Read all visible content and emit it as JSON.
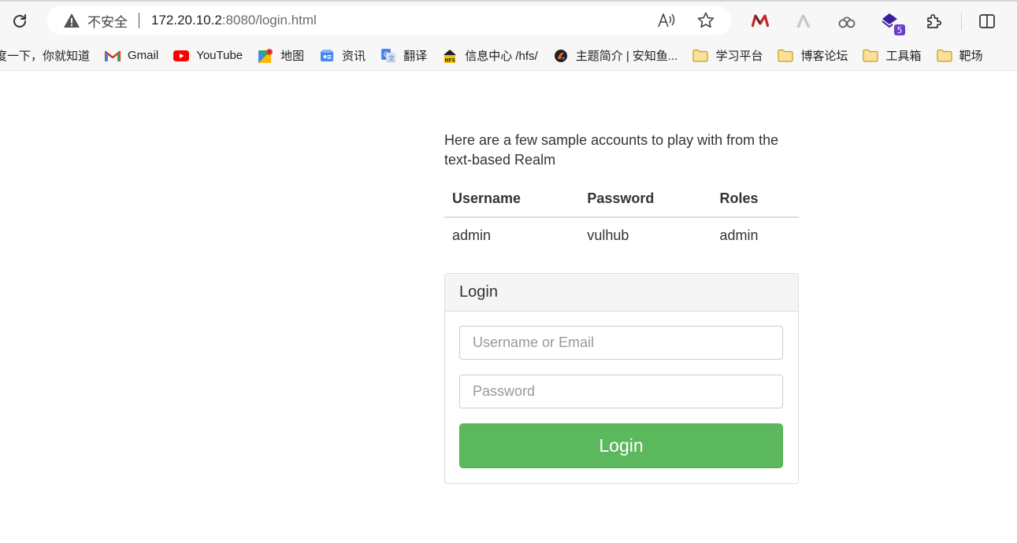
{
  "browser": {
    "security_label": "不安全",
    "url_host": "172.20.10.2",
    "url_rest": ":8080/login.html",
    "extension_badge": "5",
    "icons": {
      "reload": "reload-icon",
      "security": "warning-icon",
      "read_aloud": "read-aloud-icon",
      "favorite": "star-icon",
      "extensions": "puzzle-icon",
      "split_screen": "split-screen-icon"
    }
  },
  "bookmarks": [
    {
      "label": "度一下，你就知道",
      "icon": "baidu-icon"
    },
    {
      "label": "Gmail",
      "icon": "gmail-icon"
    },
    {
      "label": "YouTube",
      "icon": "youtube-icon"
    },
    {
      "label": "地图",
      "icon": "maps-icon"
    },
    {
      "label": "资讯",
      "icon": "news-icon"
    },
    {
      "label": "翻译",
      "icon": "translate-icon"
    },
    {
      "label": "信息中心 /hfs/",
      "icon": "hfs-icon"
    },
    {
      "label": "主题简介 | 安知鱼...",
      "icon": "anzhiyu-icon"
    },
    {
      "label": "学习平台",
      "icon": "folder-icon"
    },
    {
      "label": "博客论坛",
      "icon": "folder-icon"
    },
    {
      "label": "工具箱",
      "icon": "folder-icon"
    },
    {
      "label": "靶场",
      "icon": "folder-icon"
    }
  ],
  "page": {
    "intro": "Here are a few sample accounts to play with from the text-based Realm",
    "table": {
      "headers": [
        "Username",
        "Password",
        "Roles"
      ],
      "rows": [
        [
          "admin",
          "vulhub",
          "admin"
        ]
      ]
    },
    "login": {
      "title": "Login",
      "username_placeholder": "Username or Email",
      "username_value": "",
      "password_placeholder": "Password",
      "password_value": "",
      "button_label": "Login"
    }
  },
  "colors": {
    "button": "#5cb85c",
    "panel_heading_bg": "#f5f5f5",
    "youtube_red": "#ff0000",
    "folder_yellow": "#f7c948"
  }
}
